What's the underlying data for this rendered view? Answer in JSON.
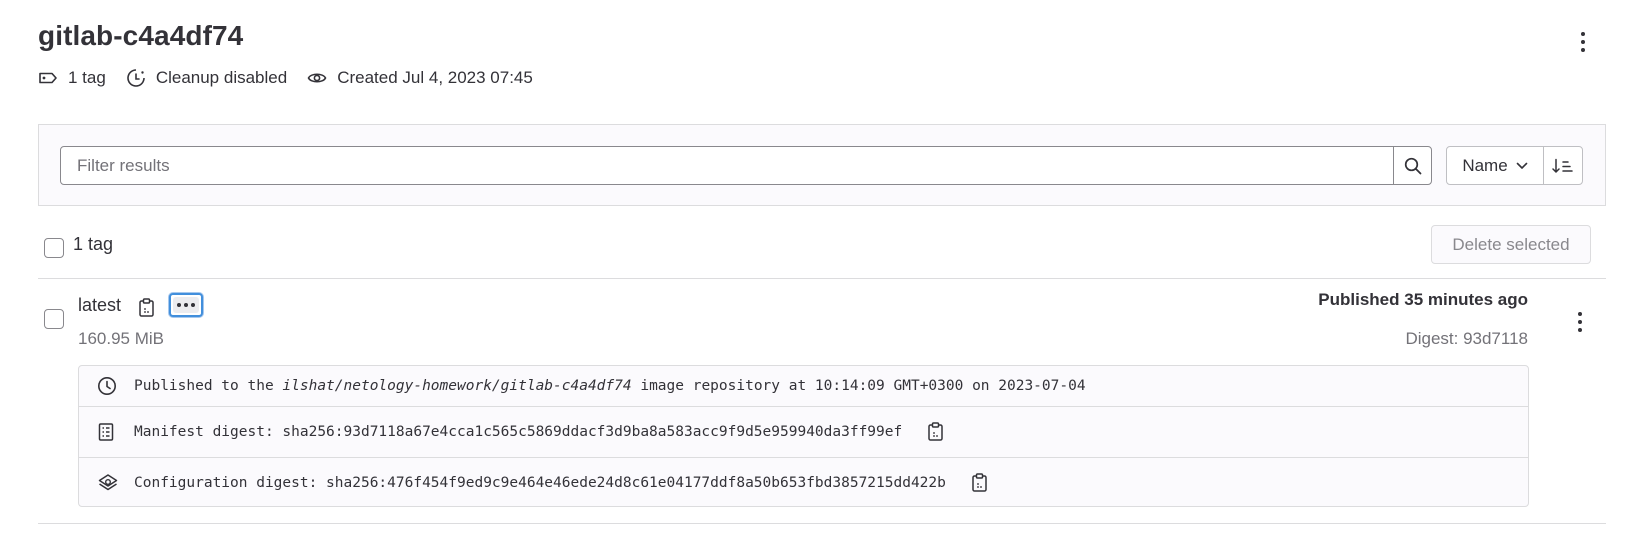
{
  "header": {
    "title": "gitlab-c4a4df74",
    "tag_count": "1 tag",
    "cleanup": "Cleanup disabled",
    "created": "Created Jul 4, 2023 07:45"
  },
  "filter": {
    "placeholder": "Filter results",
    "sort_label": "Name"
  },
  "tags_list": {
    "header_label": "1 tag",
    "delete_selected_label": "Delete selected"
  },
  "tag": {
    "name": "latest",
    "size": "160.95 MiB",
    "published": "Published 35 minutes ago",
    "digest_short": "Digest: 93d7118",
    "details": {
      "published_prefix": "Published to the ",
      "repository_path": "ilshat/netology-homework/gitlab-c4a4df74",
      "published_suffix": " image repository at 10:14:09 GMT+0300 on 2023-07-04",
      "manifest_digest": "Manifest digest: sha256:93d7118a67e4cca1c565c5869ddacf3d9ba8a583acc9f9d5e959940da3ff99ef",
      "configuration_digest": "Configuration digest: sha256:476f454f9ed9c9e464e46ede24d8c61e04177ddf8a50b653fbd3857215dd422b"
    }
  },
  "icons": {
    "tag": "tag-icon",
    "cleanup": "clock-cleanup-icon",
    "visibility": "eye-icon",
    "search": "search-icon",
    "sort_direction": "sort-lowest-icon",
    "copy": "copy-to-clipboard-icon",
    "clock": "clock-icon",
    "manifest": "document-icon",
    "configuration": "cloud-gear-icon"
  },
  "colors": {
    "text": "#333238",
    "muted": "#737278",
    "focus": "#428fdc",
    "border": "#dcdcde",
    "panel_bg": "#fbfafd"
  }
}
